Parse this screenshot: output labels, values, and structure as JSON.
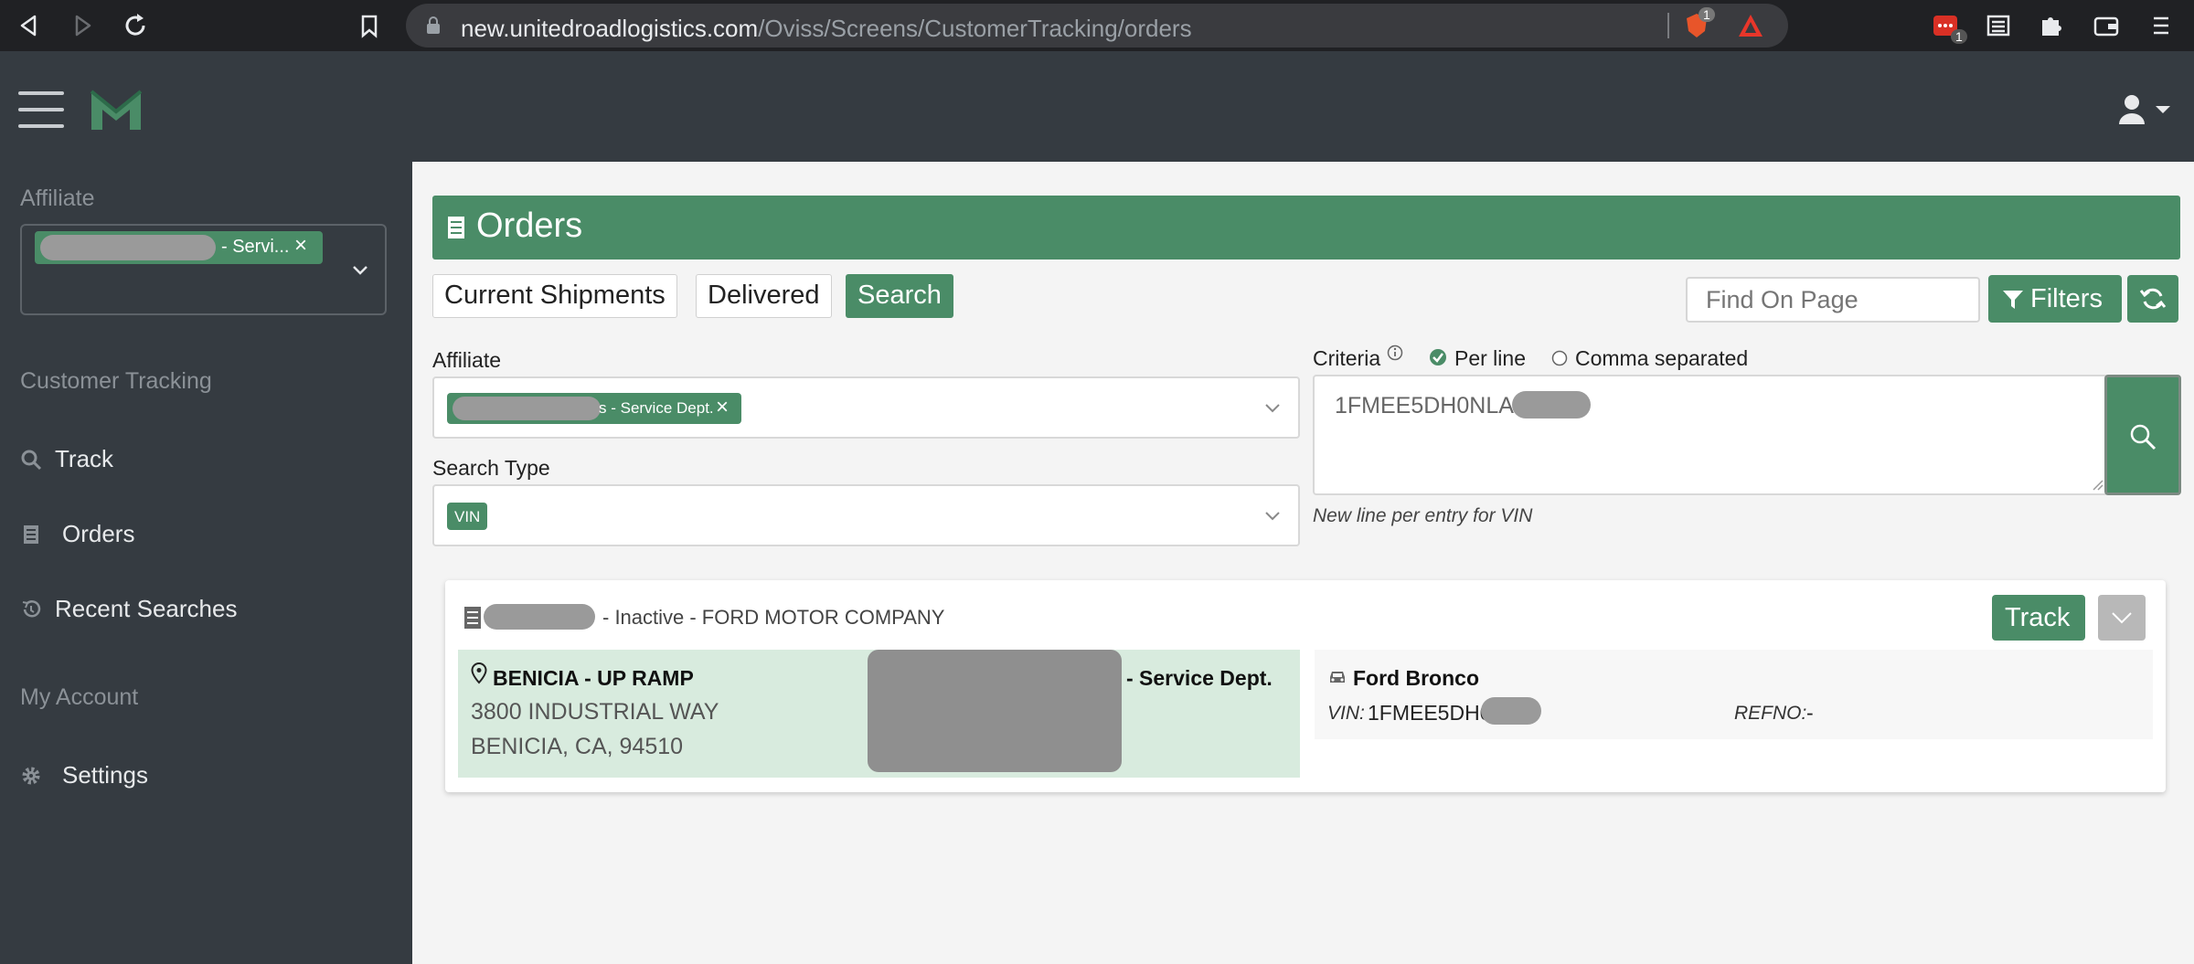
{
  "browser": {
    "url_domain": "new.unitedroadlogistics.com",
    "url_path": "/Oviss/Screens/CustomerTracking/orders",
    "brave_badge": "1",
    "ext_badge": "1"
  },
  "sidebar": {
    "affiliate_label": "Affiliate",
    "affiliate_chip_suffix": "- Servi...",
    "section_customer_tracking": "Customer Tracking",
    "items": [
      {
        "label": "Track",
        "icon": "search-icon"
      },
      {
        "label": "Orders",
        "icon": "receipt-icon"
      },
      {
        "label": "Recent Searches",
        "icon": "history-icon"
      }
    ],
    "section_my_account": "My Account",
    "settings_label": "Settings"
  },
  "main": {
    "title": "Orders",
    "tabs": [
      "Current Shipments",
      "Delivered",
      "Search"
    ],
    "active_tab": "Search",
    "find_placeholder": "Find On Page",
    "filters_label": "Filters",
    "affiliate_label": "Affiliate",
    "affiliate_chip_suffix": "s - Service Dept.",
    "search_type_label": "Search Type",
    "search_type_chip": "VIN",
    "criteria_label": "Criteria",
    "criteria_options": [
      "Per line",
      "Comma separated"
    ],
    "criteria_selected": "Per line",
    "criteria_value": "1FMEE5DH0NLA",
    "criteria_hint": "New line per entry for VIN"
  },
  "result": {
    "status": "- Inactive - FORD MOTOR COMPANY",
    "track_label": "Track",
    "pickup_name": "BENICIA - UP RAMP",
    "pickup_address_1": "3800 INDUSTRIAL WAY",
    "pickup_address_2": "BENICIA, CA, 94510",
    "service_dept": "- Service Dept.",
    "vehicle_name": "Ford Bronco",
    "vin_label": "VIN:",
    "vin_value": "1FMEE5DH0NLA",
    "refno_label": "REFNO:",
    "refno_value": "-"
  },
  "colors": {
    "accent": "#4a8c67",
    "dark": "#353b41",
    "pickup_bg": "#d8ebde"
  }
}
